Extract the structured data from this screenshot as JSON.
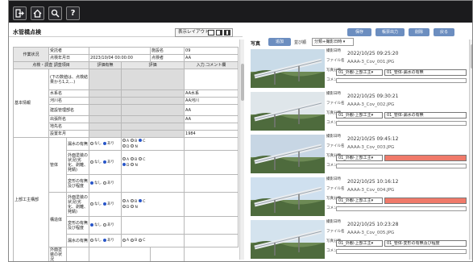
{
  "toolbar": {
    "icons": [
      "exit-icon",
      "home-icon",
      "search-refresh-icon",
      "help-icon"
    ],
    "help_label": "?"
  },
  "header": {
    "title": "水管橋点検",
    "layout_label": "表示レイアウト"
  },
  "form": {
    "status_label": "作業状況",
    "rows_top": [
      {
        "label": "受託者",
        "value": "",
        "label2": "施設名",
        "value2": "09"
      },
      {
        "label": "点検年月日",
        "value": "2023/10/04 00:00:00",
        "label2": "点検者",
        "value2": "AA"
      }
    ],
    "col_headers": [
      "点検・調査 調査項目",
      "評価有無",
      "評価",
      "入力.コメント欄"
    ],
    "basic_label": "基本情報",
    "basic_rows": [
      {
        "label": "(下の数値は、点検結果から1,2,...)",
        "value": ""
      },
      {
        "label": "水系名",
        "value": "AA水系"
      },
      {
        "label": "河川名",
        "value": "AA河川"
      },
      {
        "label": "建設管理部名",
        "value": "AA"
      },
      {
        "label": "出張所名",
        "value": "AA"
      },
      {
        "label": "地先名",
        "value": ""
      },
      {
        "label": "設置年月",
        "value": "1984"
      }
    ],
    "upper_label": "上部工主構部",
    "sub_a": "管体",
    "sub_b": "構造体",
    "eval_rows": [
      {
        "label": "漏水の有無",
        "yn": [
          "なし",
          "あり"
        ],
        "yn_on": 1,
        "grade": [
          "A",
          "B",
          "C",
          "D",
          "N"
        ],
        "grade_on": 2
      },
      {
        "label": "外面塗装の状況(劣化、剥離、発錆)",
        "yn": [
          "なし",
          "あり"
        ],
        "yn_on": 1,
        "grade": [
          "A",
          "B",
          "C",
          "D",
          "N"
        ],
        "grade_on": 3
      },
      {
        "label": "変形の有無及び程度",
        "yn": [
          "なし",
          "あり"
        ],
        "yn_on": 0,
        "grade": [
          "A",
          "B",
          "C",
          "D",
          "N"
        ],
        "grade_on": -1
      },
      {
        "label": "外面塗装の状況(劣化、剥離、発錆)",
        "yn": [
          "なし",
          "あり"
        ],
        "yn_on": 1,
        "grade": [
          "A",
          "B",
          "C",
          "D",
          "N"
        ],
        "grade_on": 2
      },
      {
        "label": "変形の有無及び程度",
        "yn": [
          "なし",
          "あり"
        ],
        "yn_on": 0,
        "grade": [
          "A",
          "B",
          "C",
          "D",
          "N"
        ],
        "grade_on": -1
      },
      {
        "label": "漏水の有無",
        "yn": [
          "なし",
          "あり"
        ],
        "yn_on": 1,
        "grade": [
          "A",
          "B",
          "C",
          "D",
          "N"
        ],
        "grade_on": -1
      },
      {
        "label": "外面塗装の状況",
        "yn": [
          "",
          ""
        ],
        "yn_on": -1,
        "grade": [],
        "grade_on": -1
      }
    ]
  },
  "photos": {
    "section_label": "写真",
    "add_label": "追加",
    "display_label": "並び順",
    "display_value": "分類+撮影日時 ▾",
    "actions": [
      "保存",
      "帳票出力",
      "削除",
      "戻る"
    ],
    "field_labels": {
      "date": "撮影日時",
      "file": "ファイル名",
      "class": "写真分類",
      "comment": "コメント"
    },
    "items": [
      {
        "date": "2022/10/25 09:25:20",
        "file": "AAAA-3_Cov_001.JPG",
        "class1": "01_外観-上部工主▾",
        "class2": "01_管体-漏水の有無",
        "warn": false
      },
      {
        "date": "2022/10/25 09:30:21",
        "file": "AAAA-3_Cov_002.JPG",
        "class1": "01_外観-上部工主▾",
        "class2": "01_管体-漏水の有無",
        "warn": false
      },
      {
        "date": "2022/10/25 09:45:12",
        "file": "AAAA-3_Cov_003.JPG",
        "class1": "01_外観-上部工主▾",
        "class2": "",
        "warn": true
      },
      {
        "date": "2022/10/25 10:16:12",
        "file": "AAAA-3_Cov_004.JPG",
        "class1": "01_外観-上部工主▾",
        "class2": "",
        "warn": true
      },
      {
        "date": "2022/10/25 10:23:28",
        "file": "AAAA-3_Cov_005.JPG",
        "class1": "01_外観-上部工主▾",
        "class2": "01_管体-変形の有無及び程度",
        "warn": false
      }
    ]
  },
  "colors": {
    "topbar": "#1b1b1d",
    "accent": "#6c8ec0",
    "warn": "#f07a6a"
  }
}
